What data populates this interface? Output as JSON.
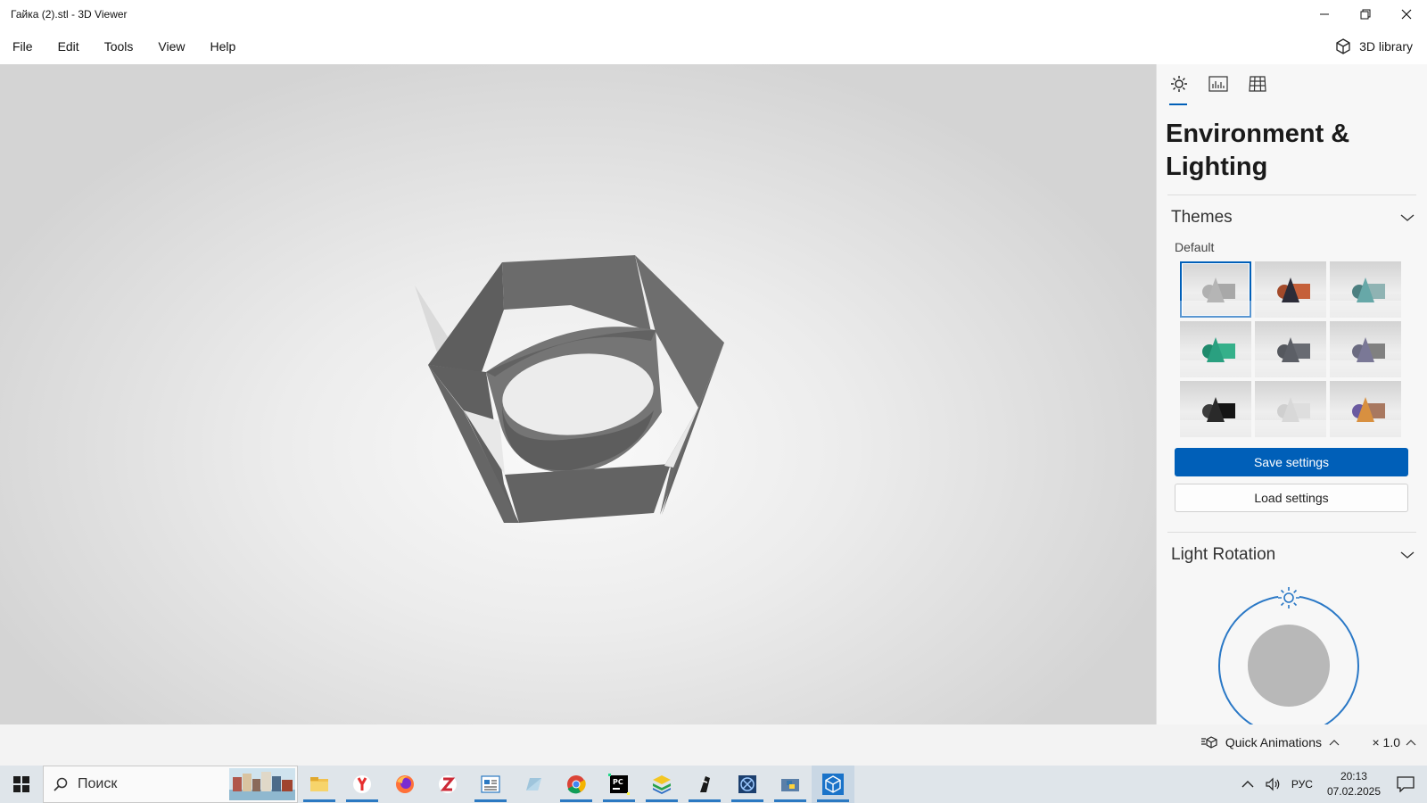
{
  "window": {
    "title": "Гайка (2).stl - 3D Viewer",
    "controls": [
      "minimize-icon",
      "restore-icon",
      "close-icon"
    ]
  },
  "menu": {
    "items": [
      "File",
      "Edit",
      "Tools",
      "View",
      "Help"
    ],
    "library_label": "3D library"
  },
  "panel": {
    "tabs": [
      "sun-icon",
      "stats-icon",
      "grid-icon"
    ],
    "active_tab": 0,
    "heading": "Environment & Lighting",
    "themes": {
      "label": "Themes",
      "group": "Default",
      "selected_index": 0,
      "tiles": [
        {
          "name": "theme-default",
          "cone": "#b5b5b5",
          "ball": "#b0b0b0",
          "box": "#a8a8a8"
        },
        {
          "name": "theme-warm",
          "cone": "#2c2c38",
          "ball": "#a34a2a",
          "box": "#c5603a"
        },
        {
          "name": "theme-teal",
          "cone": "#67a8a8",
          "ball": "#4c7f80",
          "box": "#8fb3b3"
        },
        {
          "name": "theme-green",
          "cone": "#2aa080",
          "ball": "#1f8a6c",
          "box": "#35b08a"
        },
        {
          "name": "theme-slate",
          "cone": "#5c5f66",
          "ball": "#55585e",
          "box": "#686b72"
        },
        {
          "name": "theme-lavender",
          "cone": "#7a7896",
          "ball": "#6b6b80",
          "box": "#808080"
        },
        {
          "name": "theme-dark",
          "cone": "#2a2a2a",
          "ball": "#3b3b3b",
          "box": "#151515"
        },
        {
          "name": "theme-light",
          "cone": "#d8d8d8",
          "ball": "#cfcfcf",
          "box": "#dedede"
        },
        {
          "name": "theme-sunset",
          "cone": "#d89040",
          "ball": "#6a5aa0",
          "box": "#a87860"
        }
      ],
      "save_label": "Save settings",
      "load_label": "Load settings"
    },
    "light_rotation": {
      "label": "Light Rotation"
    }
  },
  "status": {
    "quick_animations_label": "Quick Animations",
    "zoom_label": "× 1.0"
  },
  "taskbar": {
    "search_placeholder": "Поиск",
    "apps": [
      {
        "name": "file-explorer-icon",
        "running": true,
        "active": false
      },
      {
        "name": "yandex-browser-icon",
        "running": true,
        "active": false
      },
      {
        "name": "firefox-icon",
        "running": false,
        "active": false
      },
      {
        "name": "zotero-icon",
        "running": false,
        "active": false
      },
      {
        "name": "news-app-icon",
        "running": true,
        "active": false
      },
      {
        "name": "notes-app-icon",
        "running": false,
        "active": false
      },
      {
        "name": "chrome-icon",
        "running": true,
        "active": false
      },
      {
        "name": "pycharm-icon",
        "running": true,
        "active": false
      },
      {
        "name": "layers-app-icon",
        "running": true,
        "active": false
      },
      {
        "name": "terminal-app-icon",
        "running": true,
        "active": false
      },
      {
        "name": "x-app-icon",
        "running": true,
        "active": false
      },
      {
        "name": "python-icon",
        "running": true,
        "active": false
      },
      {
        "name": "3d-viewer-icon",
        "running": true,
        "active": true
      }
    ],
    "language": "РУС",
    "time": "20:13",
    "date": "07.02.2025"
  }
}
